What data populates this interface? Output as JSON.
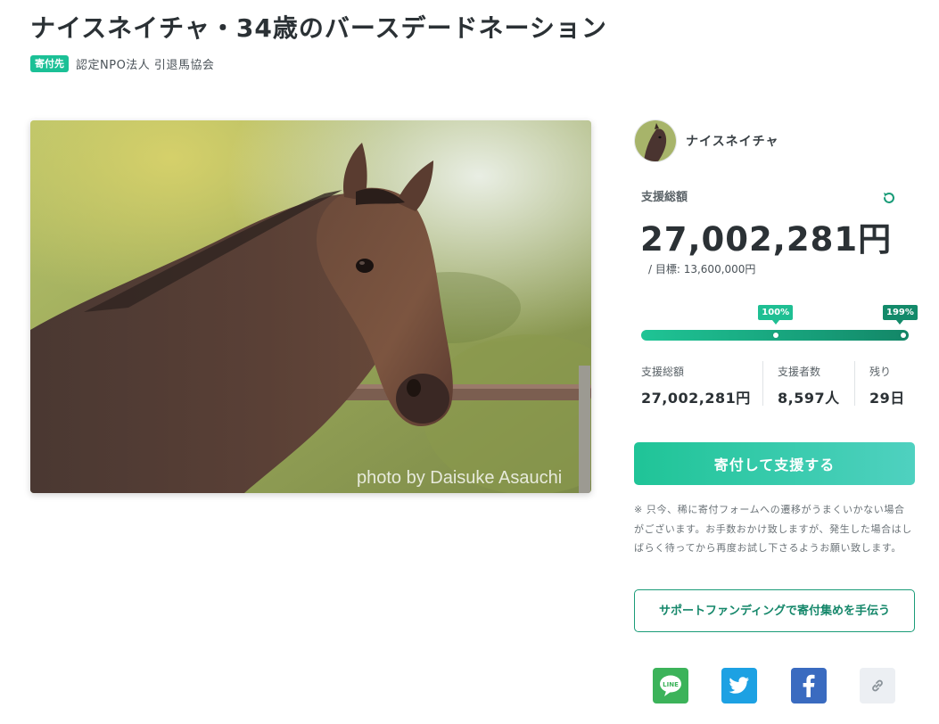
{
  "page": {
    "title": "ナイスネイチャ・34歳のバースデードネーション",
    "badge": "寄付先",
    "org": "認定NPO法人 引退馬協会"
  },
  "photo": {
    "caption": "photo by Daisuke Asauchi"
  },
  "project": {
    "name": "ナイスネイチャ"
  },
  "funding": {
    "total_label": "支援総額",
    "total_amount": "27,002,281円",
    "goal": "/ 目標: 13,600,000円",
    "progress_percent": 199,
    "milestone_percent": 100,
    "flag_milestone": "100%",
    "flag_current": "199%",
    "stats": [
      {
        "label": "支援総額",
        "value": "27,002,281円"
      },
      {
        "label": "支援者数",
        "value": "8,597人"
      },
      {
        "label": "残り",
        "value": "29日"
      }
    ]
  },
  "actions": {
    "donate_label": "寄付して支援する",
    "note": "※ 只今、稀に寄付フォームへの遷移がうまくいかない場合がございます。お手数おかけ致しますが、発生した場合はしばらく待ってから再度お試し下さるようお願い致します。",
    "support_label": "サポートファンディングで寄付集めを手伝う"
  },
  "share": {
    "line_text": "LINE",
    "icons": [
      "line-icon",
      "twitter-icon",
      "facebook-icon",
      "link-icon"
    ]
  },
  "colors": {
    "accent": "#1bc096",
    "accent_dark": "#138a6a",
    "twitter": "#1da1e3",
    "facebook": "#3a6bc0",
    "line": "#3cb35a"
  }
}
